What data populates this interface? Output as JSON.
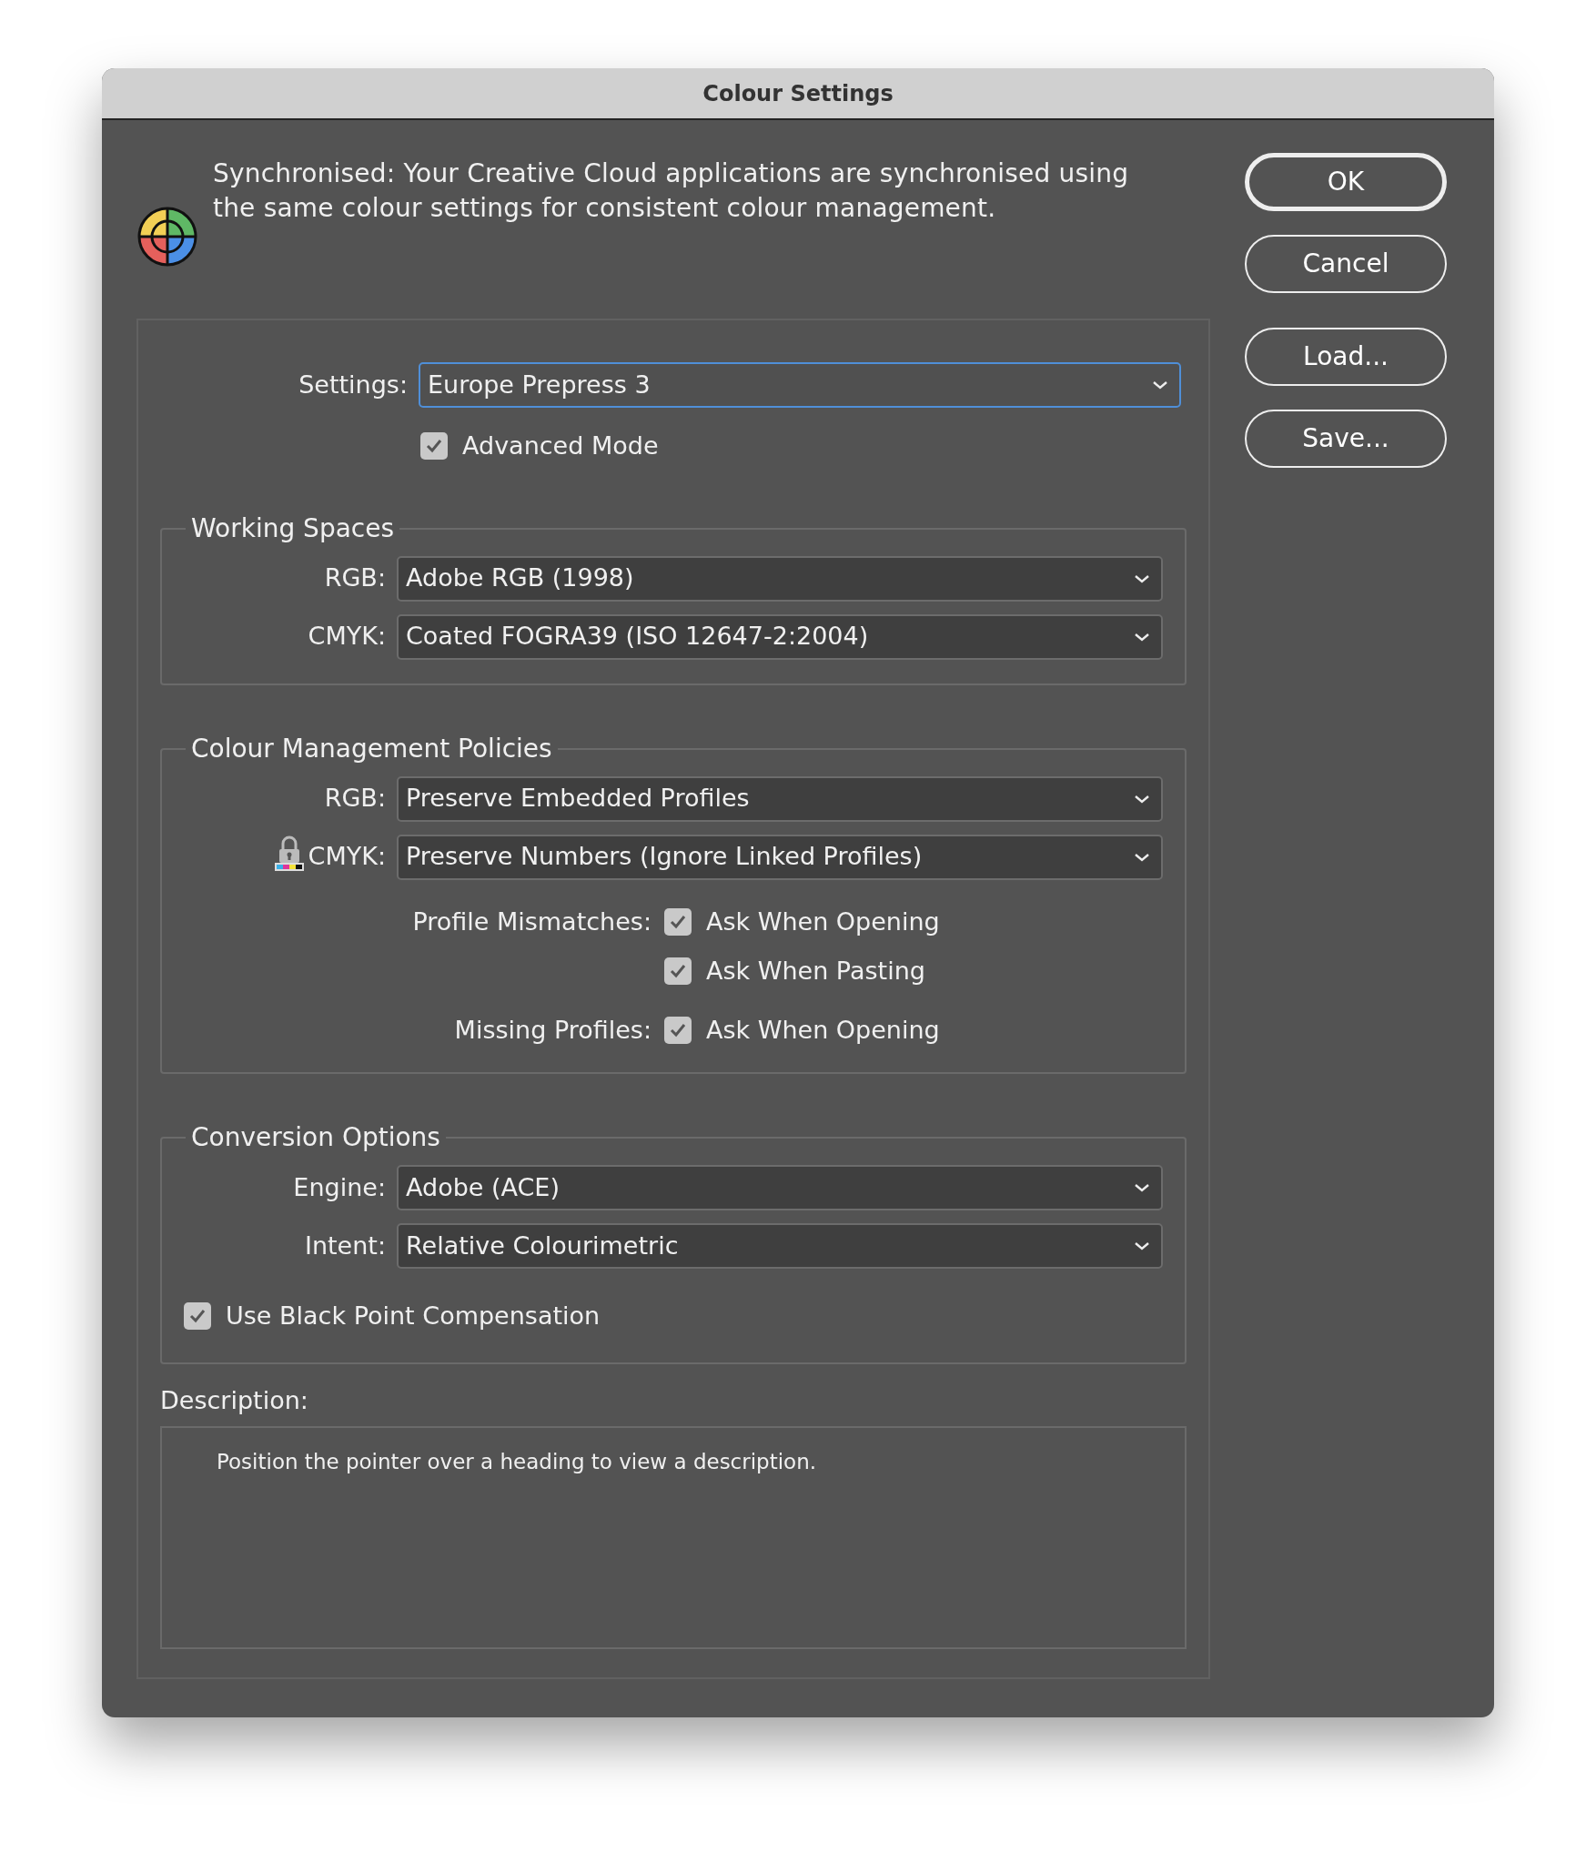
{
  "window": {
    "title": "Colour Settings"
  },
  "sync_message": "Synchronised: Your Creative Cloud applications are synchronised using the same colour settings for consistent colour management.",
  "buttons": [
    {
      "label": "OK",
      "default": true
    },
    {
      "label": "Cancel",
      "default": false
    },
    {
      "label": "Load...",
      "default": false
    },
    {
      "label": "Save...",
      "default": false
    }
  ],
  "settings": {
    "label": "Settings:",
    "value": "Europe Prepress 3",
    "focused": true
  },
  "advanced_mode": {
    "label": "Advanced Mode",
    "checked": true
  },
  "working_spaces": {
    "title": "Working Spaces",
    "fields": [
      {
        "label": "RGB:",
        "value": "Adobe RGB (1998)",
        "locked": false
      },
      {
        "label": "CMYK:",
        "value": "Coated FOGRA39 (ISO 12647-2:2004)",
        "locked": false
      }
    ]
  },
  "colour_management_policies": {
    "title": "Colour Management Policies",
    "fields": [
      {
        "label": "RGB:",
        "value": "Preserve Embedded Profiles",
        "locked": false
      },
      {
        "label": "CMYK:",
        "value": "Preserve Numbers (Ignore Linked Profiles)",
        "locked": true
      }
    ],
    "checks": [
      {
        "label": "Profile Mismatches:",
        "option": "Ask When Opening",
        "checked": true
      },
      {
        "option": "Ask When Pasting",
        "checked": true
      },
      {
        "label": "Missing Profiles:",
        "option": "Ask When Opening",
        "checked": true
      }
    ]
  },
  "conversion_options": {
    "title": "Conversion Options",
    "fields": [
      {
        "label": "Engine:",
        "value": "Adobe (ACE)",
        "locked": false
      },
      {
        "label": "Intent:",
        "value": "Relative Colourimetric",
        "locked": false
      }
    ],
    "black_point": {
      "label": "Use Black Point Compensation",
      "checked": true
    }
  },
  "description": {
    "label": "Description:",
    "text": "Position the pointer over a heading to view a description."
  }
}
